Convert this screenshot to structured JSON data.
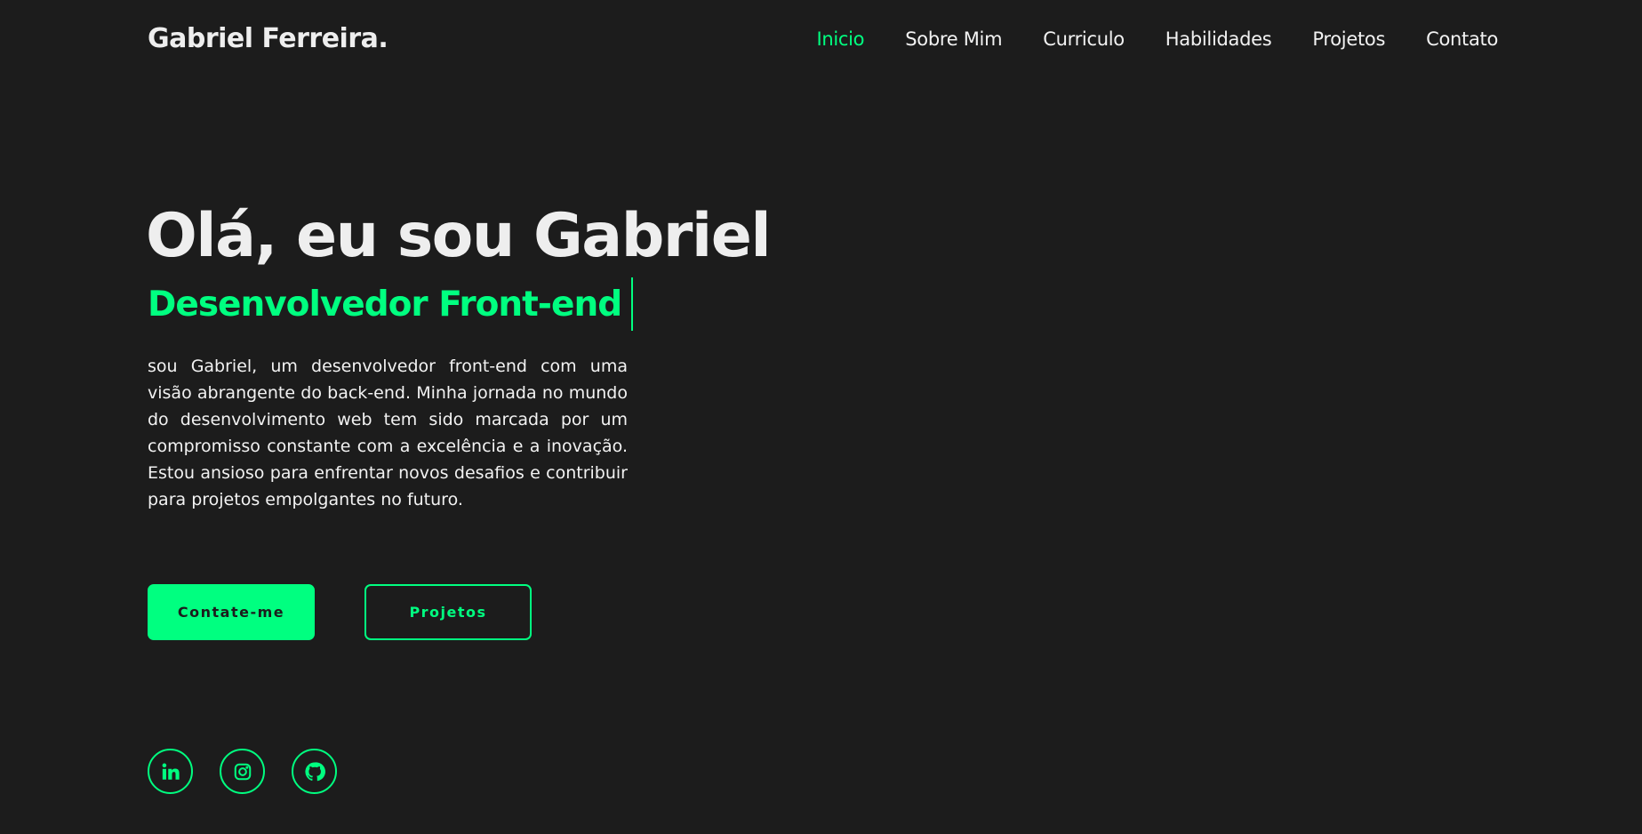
{
  "header": {
    "logo": "Gabriel Ferreira.",
    "nav": [
      {
        "label": "Inicio",
        "active": true
      },
      {
        "label": "Sobre Mim",
        "active": false
      },
      {
        "label": "Curriculo",
        "active": false
      },
      {
        "label": "Habilidades",
        "active": false
      },
      {
        "label": "Projetos",
        "active": false
      },
      {
        "label": "Contato",
        "active": false
      }
    ]
  },
  "hero": {
    "title": "Olá, eu sou Gabriel",
    "role": "Desenvolvedor Front-end",
    "description": "sou Gabriel, um desenvolvedor front-end com uma visão abrangente do back-end. Minha jornada no mundo do desenvolvimento web tem sido marcada por um compromisso constante com a excelência e a inovação. Estou ansioso para enfrentar novos desafios e contribuir para projetos empolgantes no futuro.",
    "primary_button": "Contate-me",
    "secondary_button": "Projetos"
  },
  "socials": [
    {
      "icon": "linkedin-icon"
    },
    {
      "icon": "instagram-icon"
    },
    {
      "icon": "github-icon"
    }
  ],
  "colors": {
    "background": "#1c1c1c",
    "accent": "#00ff80",
    "text": "#f2f2f2"
  }
}
